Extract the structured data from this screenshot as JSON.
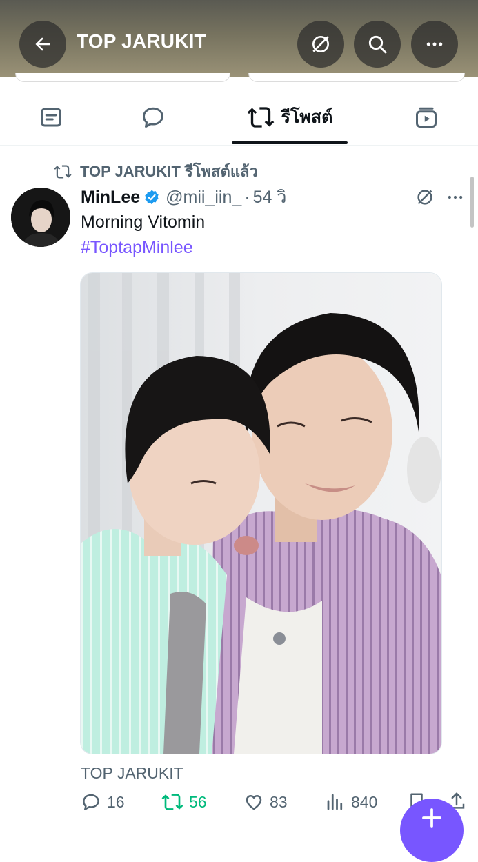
{
  "header": {
    "title": "TOP JARUKIT",
    "back_icon": "back-arrow-icon",
    "actions": [
      "grok-icon",
      "search-icon",
      "more-icon"
    ]
  },
  "tabs": [
    {
      "icon": "posts-icon",
      "label": ""
    },
    {
      "icon": "replies-icon",
      "label": ""
    },
    {
      "icon": "repost-icon",
      "label": "รีโพสต์",
      "active": true
    },
    {
      "icon": "media-icon",
      "label": ""
    }
  ],
  "repost_context": {
    "text": "TOP JARUKIT รีโพสต์แล้ว"
  },
  "post": {
    "display_name": "MinLee",
    "verified": true,
    "handle": "@mii_iin_",
    "separator": "·",
    "time": "54 วิ",
    "text": "Morning Vitomin",
    "hashtag": "#ToptapMinlee",
    "media_tag": "TOP JARUKIT",
    "stats": {
      "replies": "16",
      "reposts": "56",
      "likes": "83",
      "views": "840"
    }
  },
  "colors": {
    "accent": "#7856ff",
    "repost_green": "#00ba7c",
    "verified_blue": "#1d9bf0",
    "muted": "#536471"
  }
}
